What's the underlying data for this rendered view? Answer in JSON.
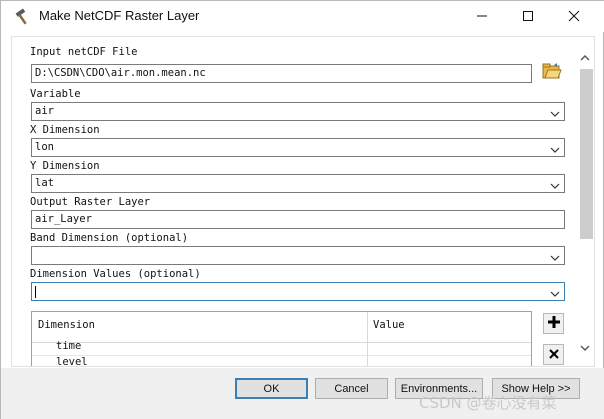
{
  "window": {
    "title": "Make NetCDF Raster Layer",
    "icon": "hammer-icon"
  },
  "titlebar_controls": {
    "minimize": "minimize-icon",
    "maximize": "maximize-icon",
    "close": "close-icon"
  },
  "form": {
    "input_file_label": "Input netCDF File",
    "input_file_value": "D:\\CSDN\\CDO\\air.mon.mean.nc",
    "variable_label": "Variable",
    "variable_value": "air",
    "x_dimension_label": "X Dimension",
    "x_dimension_value": "lon",
    "y_dimension_label": "Y Dimension",
    "y_dimension_value": "lat",
    "output_label": "Output Raster Layer",
    "output_value": "air_Layer",
    "band_dimension_label": "Band Dimension (optional)",
    "band_dimension_value": "",
    "dimension_values_label": "Dimension Values (optional)",
    "dimension_values_value": ""
  },
  "dimension_table": {
    "headers": [
      "Dimension",
      "Value"
    ],
    "rows": [
      {
        "dimension": "time",
        "value": ""
      },
      {
        "dimension": "level",
        "value": ""
      }
    ]
  },
  "buttons": {
    "ok": "OK",
    "cancel": "Cancel",
    "environments": "Environments...",
    "show_help": "Show Help >>"
  },
  "watermark": "CSDN @卷心没有菜",
  "colors": {
    "accent": "#3c7fb1",
    "folder": "#e8b84a",
    "add_button": "#000000",
    "footer_bg": "#f0f0f0"
  }
}
